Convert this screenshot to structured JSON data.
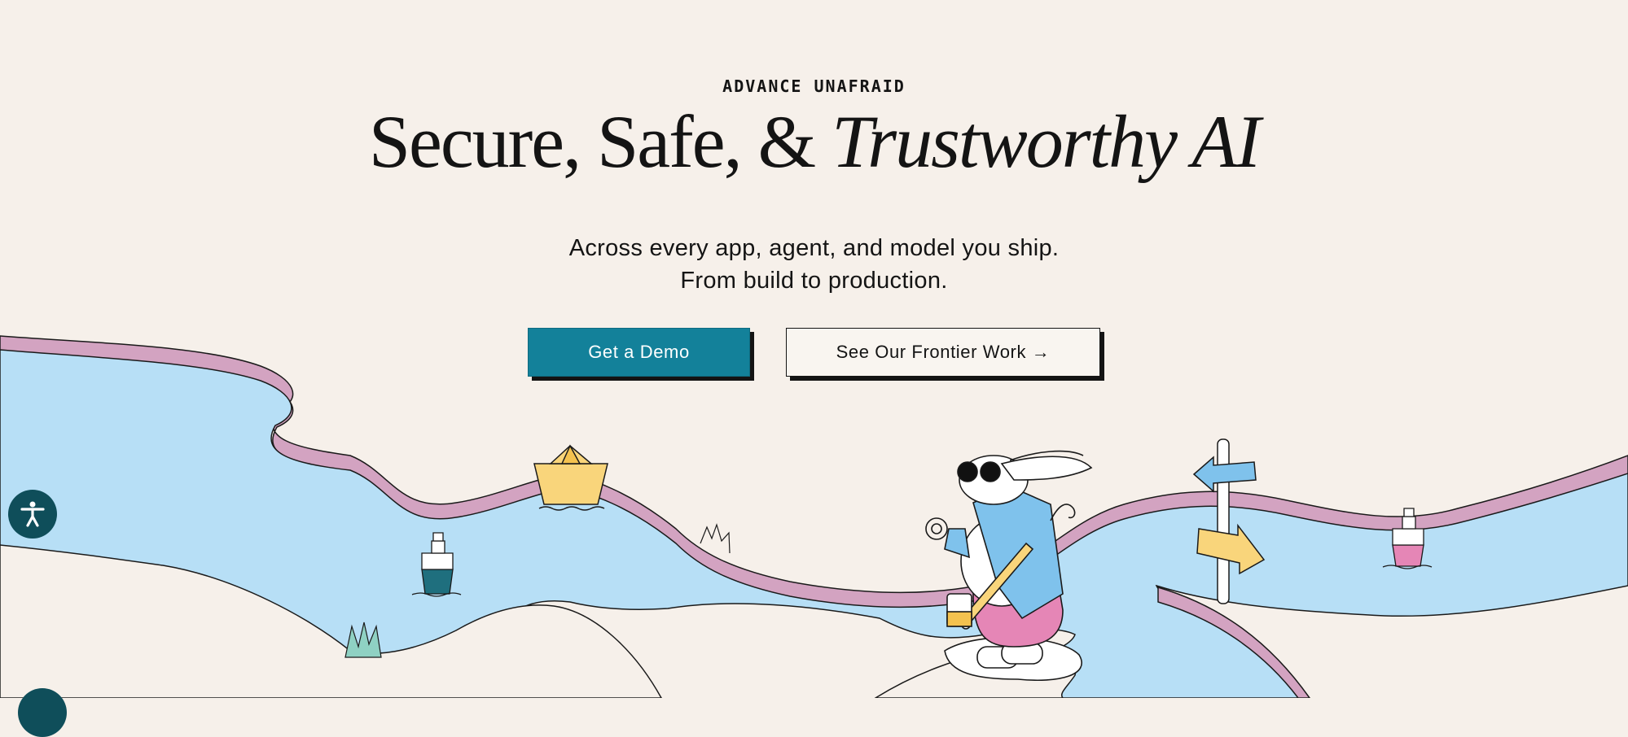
{
  "hero": {
    "eyebrow": "ADVANCE UNAFRAID",
    "title_regular": "Secure, Safe, & ",
    "title_italic": "Trustworthy AI",
    "subtitle_line1": "Across every app, agent, and model you ship.",
    "subtitle_line2": "From build to production."
  },
  "buttons": {
    "primary": "Get a Demo",
    "secondary": "See Our Frontier Work →"
  },
  "colors": {
    "background": "#f6f0ea",
    "primary_button": "#13819a",
    "river": "#b7dff6",
    "river_bank": "#d3a3c1",
    "accent_yellow": "#f9d57b",
    "accent_blue": "#7fc2ec",
    "accent_pink": "#e586b6"
  },
  "widgets": {
    "accessibility_icon": "accessibility-person-icon",
    "chat_icon": "chat-bubble-icon"
  }
}
